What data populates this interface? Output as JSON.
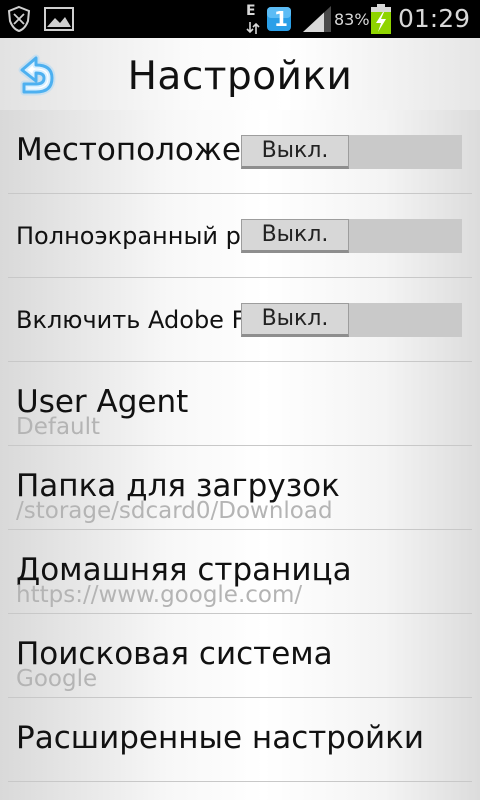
{
  "status_bar": {
    "battery_percent": "83%",
    "time": "01:29",
    "notification_badge": "1",
    "network_type": "E",
    "icons": [
      "shield-notification-icon",
      "gallery-notification-icon",
      "network-e-icon",
      "notification-badge-icon",
      "signal-icon",
      "battery-charging-icon"
    ]
  },
  "header": {
    "title": "Настройки",
    "back_icon": "back-arrow-icon"
  },
  "settings": [
    {
      "title": "Местоположение",
      "toggle_label": "Выкл.",
      "value": "off"
    },
    {
      "title": "Полноэкранный режим",
      "toggle_label": "Выкл.",
      "value": "off"
    },
    {
      "title": "Включить Adobe Flash",
      "toggle_label": "Выкл.",
      "value": "off"
    },
    {
      "title": "User Agent",
      "subtitle": "Default"
    },
    {
      "title": "Папка для загрузок",
      "subtitle": "/storage/sdcard0/Download"
    },
    {
      "title": "Домашняя страница",
      "subtitle": "https://www.google.com/"
    },
    {
      "title": "Поисковая система",
      "subtitle": "Google"
    },
    {
      "title": "Расширенные настройки"
    }
  ],
  "colors": {
    "accent_blue": "#2a9fe8",
    "battery_green": "#8fd400",
    "subtitle_gray": "#b4b4b4",
    "toggle_bg": "#c9c9c9"
  }
}
